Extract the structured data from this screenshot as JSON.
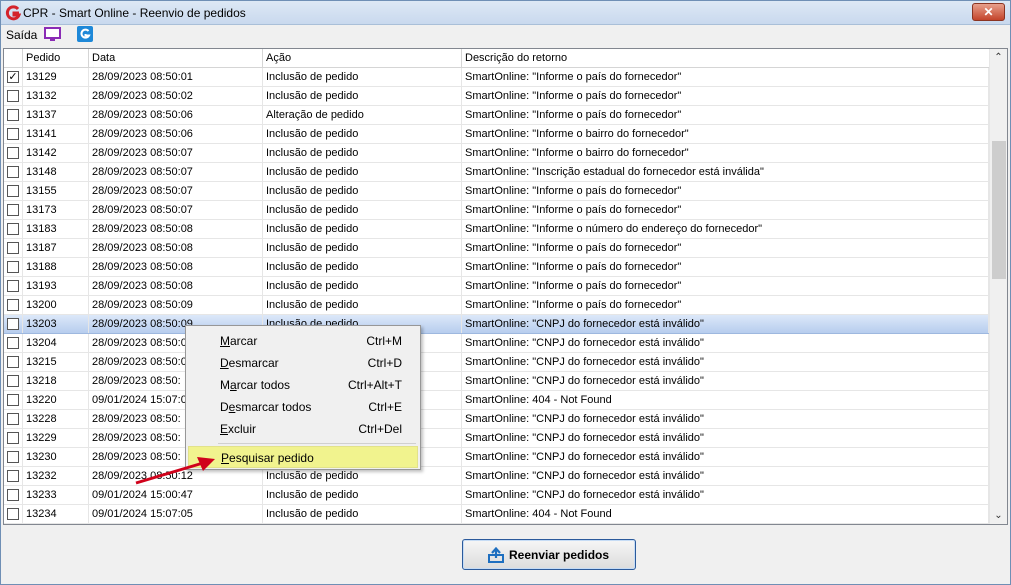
{
  "window": {
    "title": "CPR - Smart Online - Reenvio de pedidos",
    "close_glyph": "✕"
  },
  "menu": {
    "saida": "Saída",
    "icons": [
      "monitor-icon",
      "g-logo-icon"
    ]
  },
  "grid": {
    "columns": [
      "Pedido",
      "Data",
      "Ação",
      "Descrição do retorno"
    ],
    "rows": [
      {
        "checked": true,
        "pedido": "13129",
        "data": "28/09/2023 08:50:01",
        "acao": "Inclusão de pedido",
        "descricao": "SmartOnline: \"Informe o país do fornecedor\""
      },
      {
        "checked": false,
        "pedido": "13132",
        "data": "28/09/2023 08:50:02",
        "acao": "Inclusão de pedido",
        "descricao": "SmartOnline: \"Informe o país do fornecedor\""
      },
      {
        "checked": false,
        "pedido": "13137",
        "data": "28/09/2023 08:50:06",
        "acao": "Alteração de pedido",
        "descricao": "SmartOnline: \"Informe o país do fornecedor\""
      },
      {
        "checked": false,
        "pedido": "13141",
        "data": "28/09/2023 08:50:06",
        "acao": "Inclusão de pedido",
        "descricao": "SmartOnline: \"Informe o bairro do fornecedor\""
      },
      {
        "checked": false,
        "pedido": "13142",
        "data": "28/09/2023 08:50:07",
        "acao": "Inclusão de pedido",
        "descricao": "SmartOnline: \"Informe o bairro do fornecedor\""
      },
      {
        "checked": false,
        "pedido": "13148",
        "data": "28/09/2023 08:50:07",
        "acao": "Inclusão de pedido",
        "descricao": "SmartOnline: \"Inscrição estadual do fornecedor está inválida\""
      },
      {
        "checked": false,
        "pedido": "13155",
        "data": "28/09/2023 08:50:07",
        "acao": "Inclusão de pedido",
        "descricao": "SmartOnline: \"Informe o país do fornecedor\""
      },
      {
        "checked": false,
        "pedido": "13173",
        "data": "28/09/2023 08:50:07",
        "acao": "Inclusão de pedido",
        "descricao": "SmartOnline: \"Informe o país do fornecedor\""
      },
      {
        "checked": false,
        "pedido": "13183",
        "data": "28/09/2023 08:50:08",
        "acao": "Inclusão de pedido",
        "descricao": "SmartOnline: \"Informe o número do endereço do fornecedor\""
      },
      {
        "checked": false,
        "pedido": "13187",
        "data": "28/09/2023 08:50:08",
        "acao": "Inclusão de pedido",
        "descricao": "SmartOnline: \"Informe o país do fornecedor\""
      },
      {
        "checked": false,
        "pedido": "13188",
        "data": "28/09/2023 08:50:08",
        "acao": "Inclusão de pedido",
        "descricao": "SmartOnline: \"Informe o país do fornecedor\""
      },
      {
        "checked": false,
        "pedido": "13193",
        "data": "28/09/2023 08:50:08",
        "acao": "Inclusão de pedido",
        "descricao": "SmartOnline: \"Informe o país do fornecedor\""
      },
      {
        "checked": false,
        "pedido": "13200",
        "data": "28/09/2023 08:50:09",
        "acao": "Inclusão de pedido",
        "descricao": "SmartOnline: \"Informe o país do fornecedor\""
      },
      {
        "checked": false,
        "pedido": "13203",
        "data": "28/09/2023 08:50:09",
        "acao": "Inclusão de pedido",
        "descricao": "SmartOnline: \"CNPJ do fornecedor está inválido\""
      },
      {
        "checked": false,
        "pedido": "13204",
        "data": "28/09/2023 08:50:0",
        "acao": "",
        "descricao": "SmartOnline: \"CNPJ do fornecedor está inválido\""
      },
      {
        "checked": false,
        "pedido": "13215",
        "data": "28/09/2023 08:50:0",
        "acao": "",
        "descricao": "SmartOnline: \"CNPJ do fornecedor está inválido\""
      },
      {
        "checked": false,
        "pedido": "13218",
        "data": "28/09/2023 08:50:",
        "acao": "",
        "descricao": "SmartOnline: \"CNPJ do fornecedor está inválido\""
      },
      {
        "checked": false,
        "pedido": "13220",
        "data": "09/01/2024 15:07:0",
        "acao": "",
        "descricao": "SmartOnline: 404 - Not Found"
      },
      {
        "checked": false,
        "pedido": "13228",
        "data": "28/09/2023 08:50:",
        "acao": "",
        "descricao": "SmartOnline: \"CNPJ do fornecedor está inválido\""
      },
      {
        "checked": false,
        "pedido": "13229",
        "data": "28/09/2023 08:50:",
        "acao": "",
        "descricao": "SmartOnline: \"CNPJ do fornecedor está inválido\""
      },
      {
        "checked": false,
        "pedido": "13230",
        "data": "28/09/2023 08:50:",
        "acao": "",
        "descricao": "SmartOnline: \"CNPJ do fornecedor está inválido\""
      },
      {
        "checked": false,
        "pedido": "13232",
        "data": "28/09/2023 08:50:12",
        "acao": "Inclusão de pedido",
        "descricao": "SmartOnline: \"CNPJ do fornecedor está inválido\""
      },
      {
        "checked": false,
        "pedido": "13233",
        "data": "09/01/2024 15:00:47",
        "acao": "Inclusão de pedido",
        "descricao": "SmartOnline: \"CNPJ do fornecedor está inválido\""
      },
      {
        "checked": false,
        "pedido": "13234",
        "data": "09/01/2024 15:07:05",
        "acao": "Inclusão de pedido",
        "descricao": "SmartOnline: 404 - Not Found"
      }
    ],
    "selected_row": 13,
    "check_glyph": "✓"
  },
  "scrollbar": {
    "up_glyph": "⌃",
    "down_glyph": "⌄"
  },
  "context_menu": {
    "items": [
      {
        "label": "Marcar",
        "mnemonic": "M",
        "rest": "arcar",
        "shortcut": "Ctrl+M"
      },
      {
        "label": "Desmarcar",
        "mnemonic": "D",
        "rest": "esmarcar",
        "shortcut": "Ctrl+D"
      },
      {
        "label": "Marcar todos",
        "mnemonic": "a",
        "pre": "M",
        "rest": "rcar todos",
        "shortcut": "Ctrl+Alt+T"
      },
      {
        "label": "Desmarcar todos",
        "mnemonic": "e",
        "pre": "D",
        "rest": "smarcar todos",
        "shortcut": "Ctrl+E"
      },
      {
        "label": "Excluir",
        "mnemonic": "E",
        "rest": "xcluir",
        "shortcut": "Ctrl+Del"
      },
      {
        "label": "Pesquisar pedido",
        "mnemonic": "P",
        "rest": "esquisar pedido",
        "shortcut": ""
      }
    ],
    "highlighted": 5
  },
  "footer": {
    "button_label": "Reenviar pedidos"
  },
  "colors": {
    "accent": "#2b5a9b",
    "selected_row": "#b7cdee",
    "highlight": "#f1f38e",
    "arrow": "#d0021b"
  }
}
